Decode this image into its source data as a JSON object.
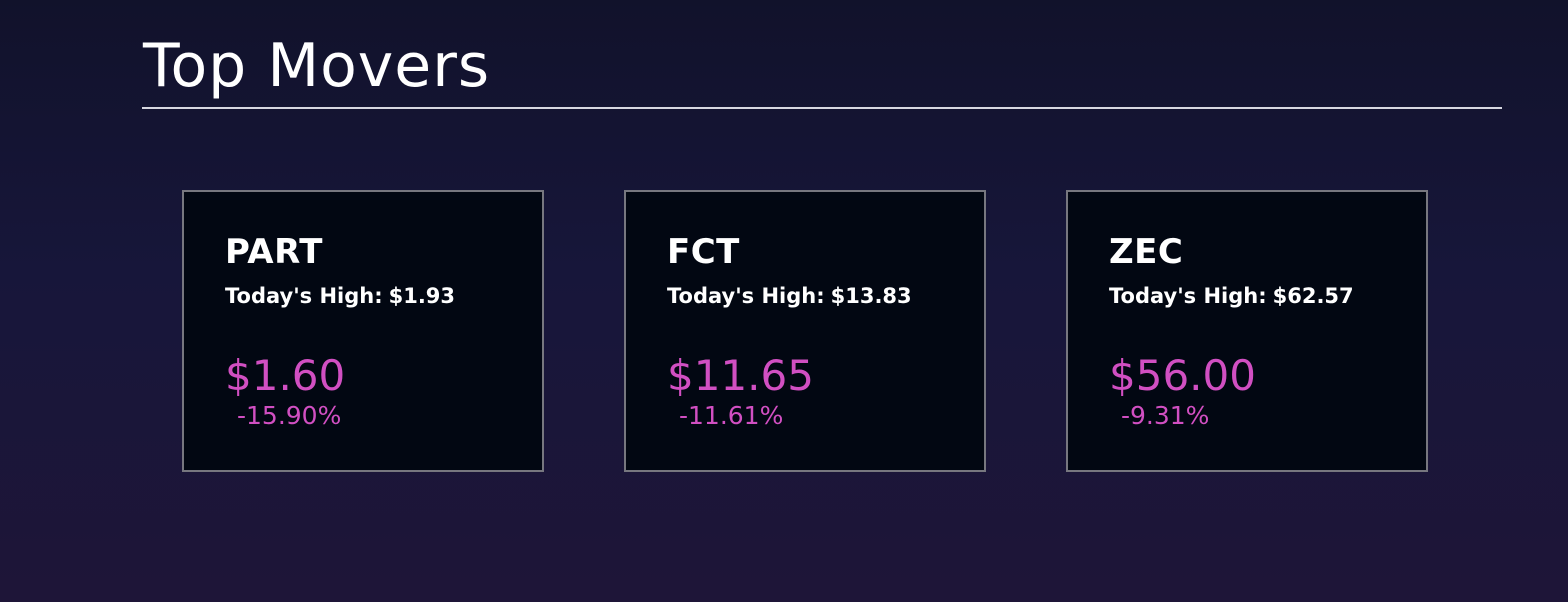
{
  "header": {
    "title": "Top Movers"
  },
  "theme": {
    "background": "#17163a",
    "card_background": "#020712",
    "card_border": "#77777f",
    "accent": "#d14fc2",
    "text": "#ffffff"
  },
  "movers": [
    {
      "symbol": "PART",
      "high_label": "Today's High:",
      "high_value": "$1.93",
      "price": "$1.60",
      "change": "-15.90%"
    },
    {
      "symbol": "FCT",
      "high_label": "Today's High:",
      "high_value": "$13.83",
      "price": "$11.65",
      "change": "-11.61%"
    },
    {
      "symbol": "ZEC",
      "high_label": "Today's High:",
      "high_value": "$62.57",
      "price": "$56.00",
      "change": "-9.31%"
    }
  ]
}
